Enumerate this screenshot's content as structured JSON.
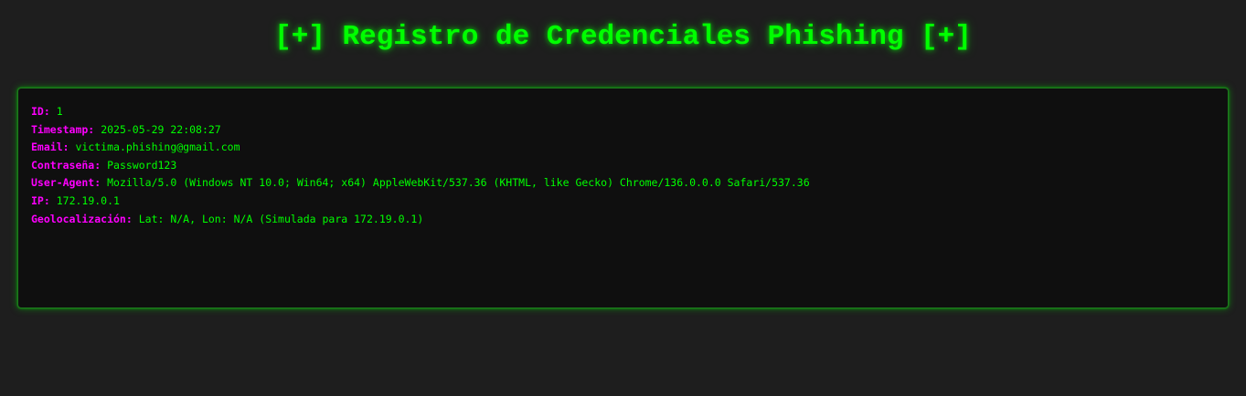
{
  "page": {
    "title": "[+] Registro de Credenciales Phishing [+]"
  },
  "entry": {
    "fields": [
      {
        "label": "ID:",
        "value": "1"
      },
      {
        "label": "Timestamp:",
        "value": "2025-05-29 22:08:27"
      },
      {
        "label": "Email:",
        "value": "victima.phishing@gmail.com"
      },
      {
        "label": "Contraseña:",
        "value": "Password123"
      },
      {
        "label": "User-Agent:",
        "value": "Mozilla/5.0 (Windows NT 10.0; Win64; x64) AppleWebKit/537.36 (KHTML, like Gecko) Chrome/136.0.0.0 Safari/537.36"
      },
      {
        "label": "IP:",
        "value": "172.19.0.1"
      },
      {
        "label": "Geolocalización:",
        "value": "Lat: N/A, Lon: N/A (Simulada para 172.19.0.1)"
      }
    ]
  },
  "colors": {
    "background": "#1e1e1e",
    "panel": "#0f0f0f",
    "accent_green": "#00ff00",
    "label_magenta": "#ff00ff"
  }
}
